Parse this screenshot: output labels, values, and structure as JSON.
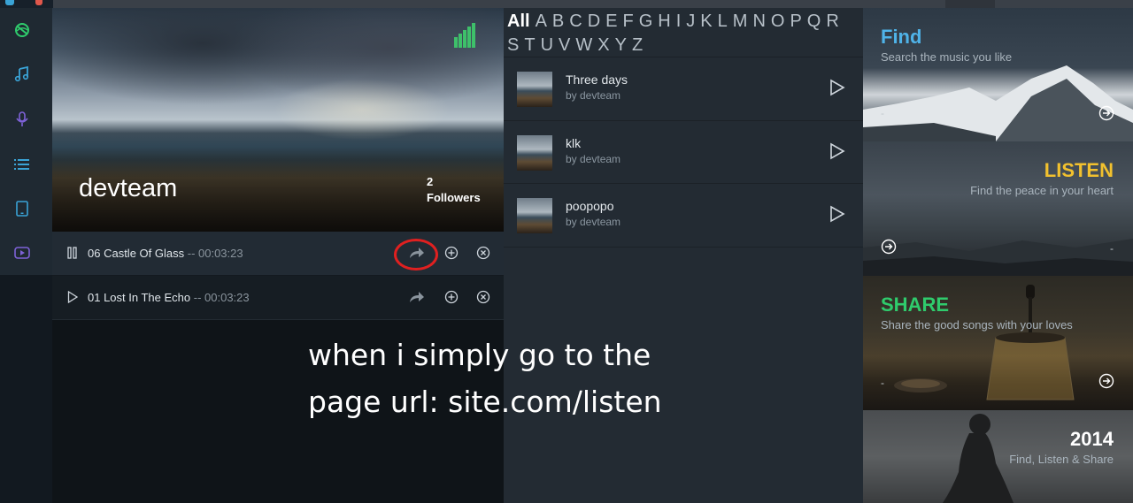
{
  "profile": {
    "name": "devteam",
    "followers_count": "2",
    "followers_label": "Followers"
  },
  "tracks": [
    {
      "title": "06 Castle Of Glass",
      "duration": "-- 00:03:23",
      "state": "playing"
    },
    {
      "title": "01 Lost In The Echo",
      "duration": "-- 00:03:23",
      "state": "stopped"
    }
  ],
  "alphabet": [
    "All",
    "A",
    "B",
    "C",
    "D",
    "E",
    "F",
    "G",
    "H",
    "I",
    "J",
    "K",
    "L",
    "M",
    "N",
    "O",
    "P",
    "Q",
    "R",
    "S",
    "T",
    "U",
    "V",
    "W",
    "X",
    "Y",
    "Z"
  ],
  "songs": [
    {
      "title": "Three days",
      "by": "by devteam"
    },
    {
      "title": "klk",
      "by": "by devteam"
    },
    {
      "title": "poopopo",
      "by": "by devteam"
    }
  ],
  "cards": [
    {
      "title": "Find",
      "subtitle": "Search the music you like",
      "color": "#4fb3e8",
      "dash": "-"
    },
    {
      "title": "LISTEN",
      "subtitle": "Find the peace in your heart",
      "color": "#f2c12e",
      "dash": "-"
    },
    {
      "title": "SHARE",
      "subtitle": "Share the good songs with your loves",
      "color": "#2fcb6c",
      "dash": "-"
    },
    {
      "title": "2014",
      "subtitle": "Find, Listen & Share",
      "color": "#ffffff",
      "dash": ""
    }
  ],
  "annotation": {
    "line1": "when i simply go to the",
    "line2": "page url: site.com/listen"
  },
  "colors": {
    "accent_green": "#3ec06a",
    "rail_icon_blue": "#3aa3d6",
    "rail_icon_purple": "#7e62d8",
    "highlight_circle": "#e02020"
  }
}
